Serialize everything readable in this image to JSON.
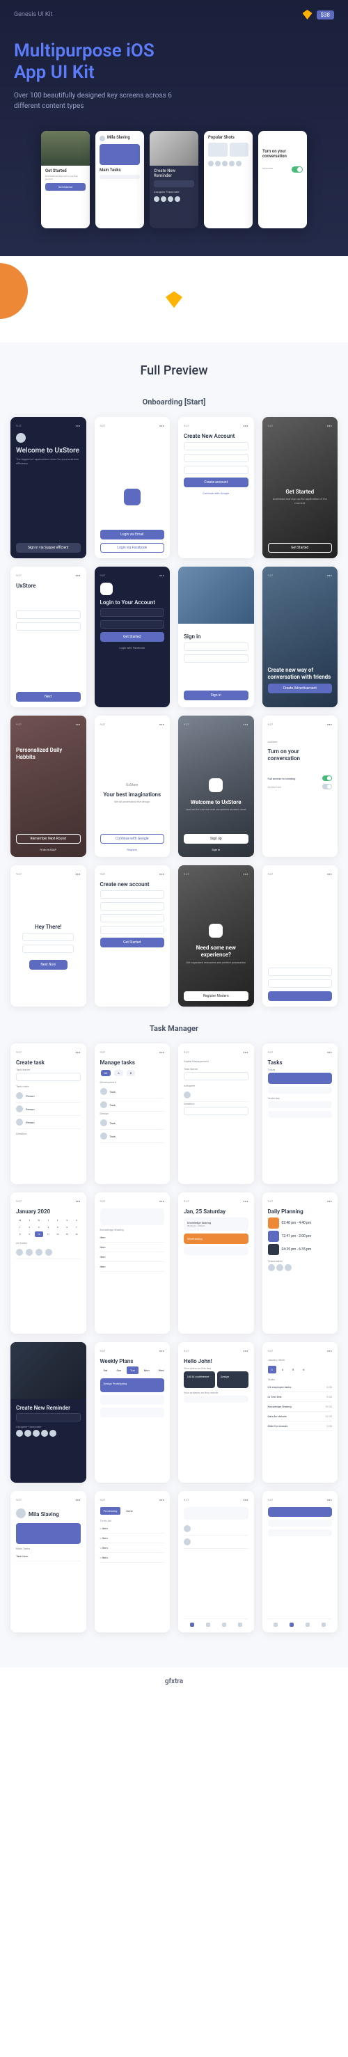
{
  "hero": {
    "brand": "Genesis UI Kit",
    "price": "$38",
    "title_line1": "Multipurpose iOS",
    "title_line2": "App UI Kit",
    "subtitle": "Over 100 beautifully designed key screens across 6 different content types"
  },
  "mockups": {
    "m1": {
      "title": "Get Started",
      "sub": "Download and sign up for your free account"
    },
    "m2": {
      "name": "Mila Slaving",
      "section": "Main Tasks"
    },
    "m3": {
      "title": "Create New Reminder",
      "section": "Assignee Teammate"
    },
    "m4": {
      "title": "Popular Shots"
    },
    "m5": {
      "title": "Turn on your conversation"
    }
  },
  "preview": {
    "title": "Full Preview",
    "onboarding_title": "Onboarding [Start]",
    "task_title": "Task Manager"
  },
  "onboarding": {
    "s1": {
      "title": "Welcome to UxStore",
      "sub": "The biggest of applications store for your business efficiency",
      "btn": "Sign in via Supper efficient"
    },
    "s2": {
      "btn": "Login via Email",
      "btn2": "Login via Facebook"
    },
    "s3": {
      "title": "Create New Account",
      "btn": "Create account",
      "link": "Continue with Google"
    },
    "s4": {
      "title": "Get Started",
      "sub": "Download and sign up/for application of the moment",
      "btn": "Get Started"
    },
    "s5": {
      "title": "UxStore",
      "btn": "Next"
    },
    "s6": {
      "title": "Login to Your Account",
      "btn": "Get Started",
      "link": "Login with Facebook"
    },
    "s7": {
      "title": "Sign in",
      "btn": "Sign in"
    },
    "s8": {
      "title": "Create new way of conversation with friends",
      "btn": "Create Advertisement"
    },
    "s9": {
      "title": "Personalized Daily Habbits",
      "btn": "Remember Next Round",
      "link": "I'll do it ASAP"
    },
    "s10": {
      "brand": "UxStore",
      "title": "Your best imaginations",
      "sub": "We all understand the design",
      "btn": "Continue with Google",
      "link": "Register"
    },
    "s11": {
      "title": "Welcome to UxStore",
      "sub": "Just be the one we best completed product most",
      "btn": "Sign up",
      "link": "Sign in"
    },
    "s12": {
      "title": "Turn on your conversation",
      "opt1": "Full access to creating"
    },
    "s13": {
      "title": "Hey There!",
      "btn": "Next Now"
    },
    "s14": {
      "title": "Create new account",
      "btn": "Get Started"
    },
    "s15": {
      "title": "Need some new experience?",
      "sub": "Get organized resources and perfect preparation",
      "btn": "Register Modern"
    },
    "s16": {}
  },
  "tasks": {
    "s1": {
      "title": "Create task",
      "label1": "Task Name",
      "label2": "Task mate",
      "label3": "Deadline"
    },
    "s2": {
      "title": "Manage tasks",
      "cat1": "Development",
      "cat2": "Design"
    },
    "s3": {
      "crumb": "Digital Management",
      "label1": "Task Name",
      "label2": "Assignee",
      "label3": "Deadline"
    },
    "s4": {
      "title": "Tasks",
      "today": "Today",
      "yest": "Yesterday"
    },
    "s5": {
      "title": "January 2020",
      "section": "All Tasks"
    },
    "s6": {
      "section": "Knowledge Sharing"
    },
    "s7": {
      "title": "Jan, 25 Saturday",
      "item1": "Knowledge Sharing",
      "time1": "08:30 am - 2:00 pm",
      "item2": "Wireframing"
    },
    "s8": {
      "title": "Daily Planning",
      "time1": "02:40 pm - 4:40 pm",
      "time2": "12:41 pm - 2:00 pm",
      "time3": "04:35 pm - 6:35 pm",
      "section": "Teammates"
    },
    "s9": {
      "title": "Create New Reminder",
      "section": "Assignee Teammate"
    },
    "s10": {
      "title": "Weekly Plans",
      "days": [
        "Sat",
        "Sun",
        "Tue",
        "Mon",
        "Wed"
      ],
      "section": "Design Prototyping"
    },
    "s11": {
      "title": "Hello John!",
      "section1": "Your plans on this day",
      "card1": "UX/UI conference",
      "card2": "Design",
      "section2": "Your projects on this month"
    },
    "s12": {
      "month": "January 2020",
      "section": "Tasks",
      "t1": "UX employee tasks",
      "t2": "UI Test test",
      "t3": "Knowledge Sharing",
      "t4": "Data for details",
      "t5": "Slide for domain"
    },
    "s13": {
      "name": "Mila Slaving",
      "section": "Main Tasks"
    },
    "s14": {
      "tab1": "Processing",
      "tab2": "Done",
      "section": "To-do list"
    }
  },
  "watermark": "gfxtra"
}
